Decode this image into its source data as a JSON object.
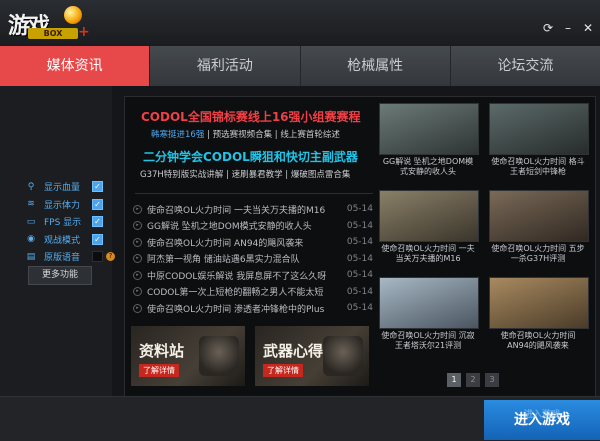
{
  "app": {
    "logo_text": "游戏",
    "logo_sub": "BOX",
    "window_controls": [
      "refresh-icon",
      "minimize-icon",
      "close-icon"
    ]
  },
  "tabs": [
    {
      "label": "媒体资讯",
      "active": true
    },
    {
      "label": "福利活动",
      "active": false
    },
    {
      "label": "枪械属性",
      "active": false
    },
    {
      "label": "论坛交流",
      "active": false
    }
  ],
  "options": [
    {
      "icon": "location-icon",
      "label": "显示血量",
      "checked": true
    },
    {
      "icon": "wifi-icon",
      "label": "显示体力",
      "checked": true
    },
    {
      "icon": "monitor-icon",
      "label": "FPS 显示",
      "checked": true
    },
    {
      "icon": "eye-icon",
      "label": "观战模式",
      "checked": true
    },
    {
      "icon": "book-icon",
      "label": "原版语音",
      "checked": false
    }
  ],
  "more_label": "更多功能",
  "headline1": "CODOL全国锦标赛线上16强小组赛赛程",
  "sub1": {
    "a": "韩寒挺进16强",
    "b": " | 预选赛视频合集 | 线上赛首轮综述"
  },
  "headline2": "二分钟学会CODOL瞬狙和快切主副武器",
  "sub2": "G37H特别版实战讲解 | 速刷暴君教学 | 爆破图点雷合集",
  "news": [
    {
      "title": "使命召唤OL火力时间 一夫当关万夫播的M16",
      "date": "05-14"
    },
    {
      "title": "GG解说 坠机之地DOM模式安静的收人头",
      "date": "05-14"
    },
    {
      "title": "使命召唤OL火力时间 AN94的飓风袭来",
      "date": "05-14"
    },
    {
      "title": "阿杰第一视角 储油站遇6黑实力混合队",
      "date": "05-14"
    },
    {
      "title": "中原CODOL娱乐解说 我屏息屏不了这么久呀",
      "date": "05-14"
    },
    {
      "title": "CODOL第一次上短枪的翻畅之男人不能太短",
      "date": "05-14"
    },
    {
      "title": "使命召唤OL火力时间 渗透者冲锋枪中的Plus",
      "date": "05-14"
    }
  ],
  "banners": [
    {
      "title": "资料站",
      "btn": "了解详情"
    },
    {
      "title": "武器心得",
      "btn": "了解详情"
    }
  ],
  "videos": [
    {
      "caption": "GG解说 坠机之地DOM模式安静的收人头",
      "c1": "#6b7a78",
      "c2": "#2e3434"
    },
    {
      "caption": "使命召唤OL火力时间 格斗王者短剑中锋枪",
      "c1": "#5c6a6a",
      "c2": "#272c2b"
    },
    {
      "caption": "使命召唤OL火力时间 一夫当关万夫播的M16",
      "c1": "#8a8068",
      "c2": "#3a352b"
    },
    {
      "caption": "使命召唤OL火力时间 五步一杀G37H评测",
      "c1": "#7a6a58",
      "c2": "#302821"
    },
    {
      "caption": "使命召唤OL火力时间 沉寂王者塔沃尔21评测",
      "c1": "#a7b8c4",
      "c2": "#4a5560"
    },
    {
      "caption": "使命召唤OL火力时间 AN94的飓风袭来",
      "c1": "#a88a60",
      "c2": "#4a3b28"
    }
  ],
  "pages": [
    "1",
    "2",
    "3"
  ],
  "enter_label": "进入游戏",
  "enter_ghost": "进入游戏"
}
